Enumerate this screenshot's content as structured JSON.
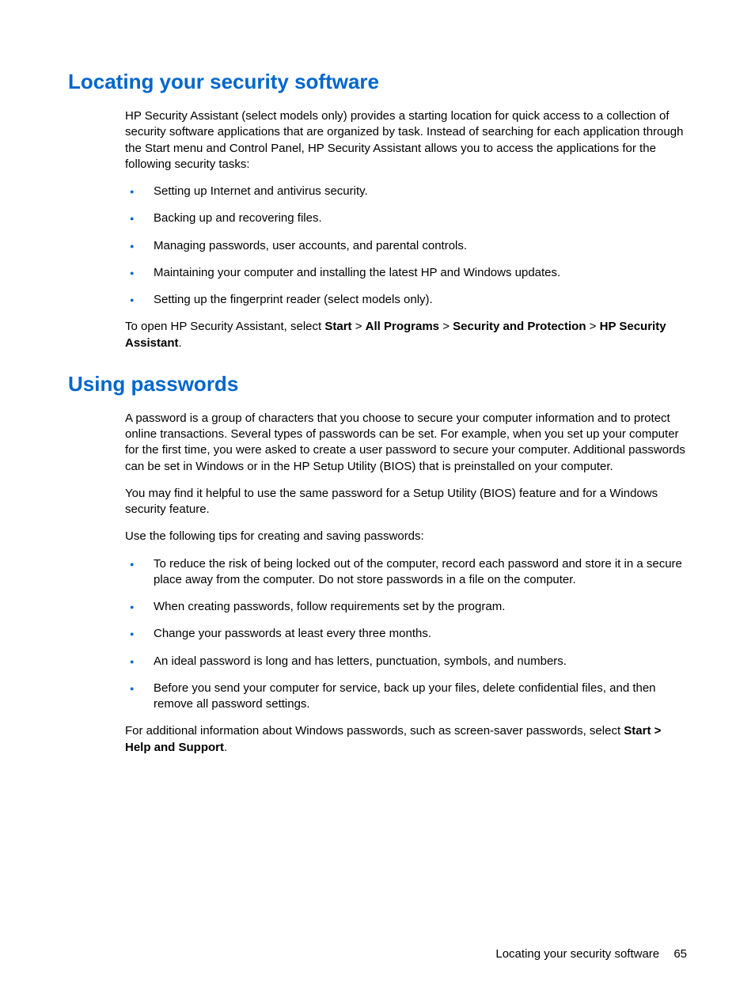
{
  "section1": {
    "heading": "Locating your security software",
    "intro": "HP Security Assistant (select models only) provides a starting location for quick access to a collection of security software applications that are organized by task. Instead of searching for each application through the Start menu and Control Panel, HP Security Assistant allows you to access the applications for the following security tasks:",
    "bullets": [
      "Setting up Internet and antivirus security.",
      "Backing up and recovering files.",
      "Managing passwords, user accounts, and parental controls.",
      "Maintaining your computer and installing the latest HP and Windows updates.",
      "Setting up the fingerprint reader (select models only)."
    ],
    "open_prefix": "To open HP Security Assistant, select ",
    "path1": "Start",
    "sep": " > ",
    "path2": "All Programs",
    "path3": "Security and Protection",
    "path4": "HP Security Assistant",
    "period": "."
  },
  "section2": {
    "heading": "Using passwords",
    "para1": "A password is a group of characters that you choose to secure your computer information and to protect online transactions. Several types of passwords can be set. For example, when you set up your computer for the first time, you were asked to create a user password to secure your computer. Additional passwords can be set in Windows or in the HP Setup Utility (BIOS) that is preinstalled on your computer.",
    "para2": "You may find it helpful to use the same password for a Setup Utility (BIOS) feature and for a Windows security feature.",
    "para3": "Use the following tips for creating and saving passwords:",
    "bullets": [
      "To reduce the risk of being locked out of the computer, record each password and store it in a secure place away from the computer. Do not store passwords in a file on the computer.",
      "When creating passwords, follow requirements set by the program.",
      "Change your passwords at least every three months.",
      "An ideal password is long and has letters, punctuation, symbols, and numbers.",
      "Before you send your computer for service, back up your files, delete confidential files, and then remove all password settings."
    ],
    "closing_prefix": "For additional information about Windows passwords, such as screen-saver passwords, select ",
    "closing_bold": "Start > Help and Support",
    "closing_period": "."
  },
  "footer": {
    "label": "Locating your security software",
    "page": "65"
  }
}
